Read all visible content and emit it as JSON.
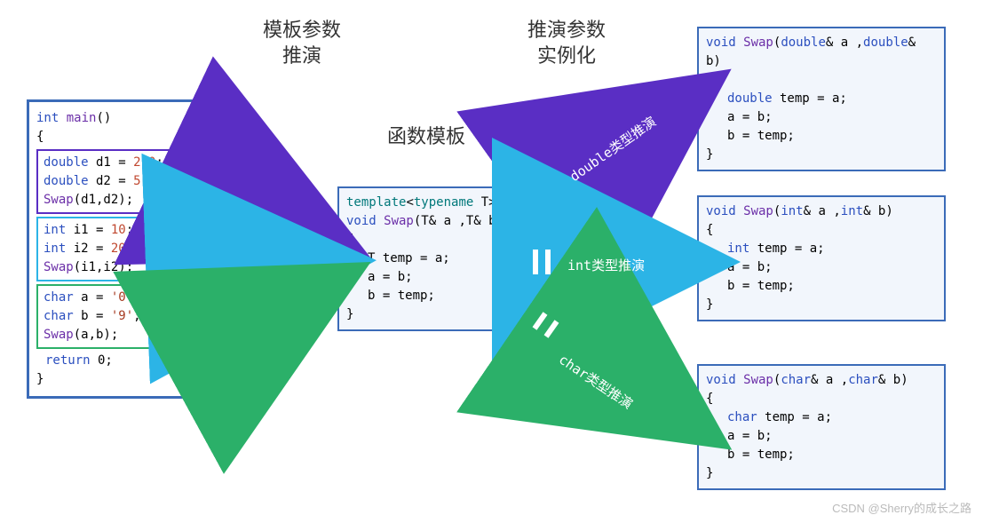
{
  "titles": {
    "left": "模板参数\n推演",
    "centerTop": "推演参数\n实例化",
    "center": "函数模板"
  },
  "main_box": {
    "sig_kw": "int",
    "sig_fn": "main",
    "sig_paren": "()",
    "open": "{",
    "close": "}",
    "block1": {
      "l1_kw": "double",
      "l1_rest": " d1 = ",
      "l1_num": "2.0",
      "l1_sc": ";",
      "l2_kw": "double",
      "l2_rest": " d2 = ",
      "l2_num": "5.0",
      "l2_sc": ";",
      "l3_fn": "Swap",
      "l3_args": "(d1,d2);"
    },
    "block2": {
      "l1_kw": "int",
      "l1_rest": " i1 = ",
      "l1_num": "10",
      "l1_sc": ";",
      "l2_kw": "int",
      "l2_rest": " i2 = ",
      "l2_num": "20",
      "l2_sc": ";",
      "l3_fn": "Swap",
      "l3_args": "(i1,i2);"
    },
    "block3": {
      "l1_kw": "char",
      "l1_rest": " a = ",
      "l1_str": "'0'",
      "l1_sc": ";",
      "l2_kw": "char",
      "l2_rest": " b = ",
      "l2_str": "'9'",
      "l2_sc": ";",
      "l3_fn": "Swap",
      "l3_args": "(a,b);"
    },
    "ret_kw": "return",
    "ret_rest": " 0;"
  },
  "template_box": {
    "l1_a": "template",
    "l1_b": "<",
    "l1_c": "typename",
    "l1_d": " T>",
    "l2_a": "void",
    "l2_b": " Swap",
    "l2_c": "(T& a ,T& b)",
    "open": "{",
    "l4_a": "T",
    "l4_b": " temp = a;",
    "l5": "a = b;",
    "l6": "b = temp;",
    "close": "}"
  },
  "out_double": {
    "l1_a": "void",
    "l1_b": " Swap",
    "l1_c": "(",
    "l1_d": "double",
    "l1_e": "& a ,",
    "l1_f": "double",
    "l1_g": "& b)",
    "open": "{",
    "l3_a": "double",
    "l3_b": " temp = a;",
    "l4": "a = b;",
    "l5": "b = temp;",
    "close": "}"
  },
  "out_int": {
    "l1_a": "void",
    "l1_b": " Swap",
    "l1_c": "(",
    "l1_d": "int",
    "l1_e": "& a ,",
    "l1_f": "int",
    "l1_g": "& b)",
    "open": "{",
    "l3_a": "int",
    "l3_b": " temp = a;",
    "l4": "a = b;",
    "l5": "b = temp;",
    "close": "}"
  },
  "out_char": {
    "l1_a": "void",
    "l1_b": " Swap",
    "l1_c": "(",
    "l1_d": "char",
    "l1_e": "& a ,",
    "l1_f": "char",
    "l1_g": "& b)",
    "open": "{",
    "l3_a": "char",
    "l3_b": " temp = a;",
    "l4": "a = b;",
    "l5": "b = temp;",
    "close": "}"
  },
  "arrows": {
    "tag_double": "double类型推演",
    "tag_int": "int类型推演",
    "tag_char": "char类型推演"
  },
  "colors": {
    "purple": "#5a2ec4",
    "cyan": "#2cb4e6",
    "green": "#2bb069"
  },
  "watermark": "CSDN @Sherry的成长之路"
}
